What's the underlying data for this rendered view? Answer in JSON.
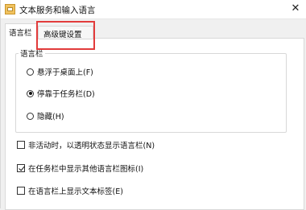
{
  "window": {
    "title": "文本服务和输入语言",
    "close_glyph": "✕"
  },
  "tabs": [
    {
      "label": "语言栏",
      "selected": true
    },
    {
      "label": "高级键设置",
      "selected": false,
      "highlighted": true,
      "highlight_color": "#e23b3b"
    }
  ],
  "language_bar_group": {
    "title": "语言栏",
    "options": [
      {
        "label": "悬浮于桌面上(F)",
        "checked": false
      },
      {
        "label": "停靠于任务栏(D)",
        "checked": true
      },
      {
        "label": "隐藏(H)",
        "checked": false
      }
    ]
  },
  "checkboxes": [
    {
      "label": "非活动时，以透明状态显示语言栏(N)",
      "checked": false
    },
    {
      "label": "在任务栏中显示其他语言栏图标(I)",
      "checked": true
    },
    {
      "label": "在语言栏上显示文本标签(E)",
      "checked": false
    }
  ]
}
